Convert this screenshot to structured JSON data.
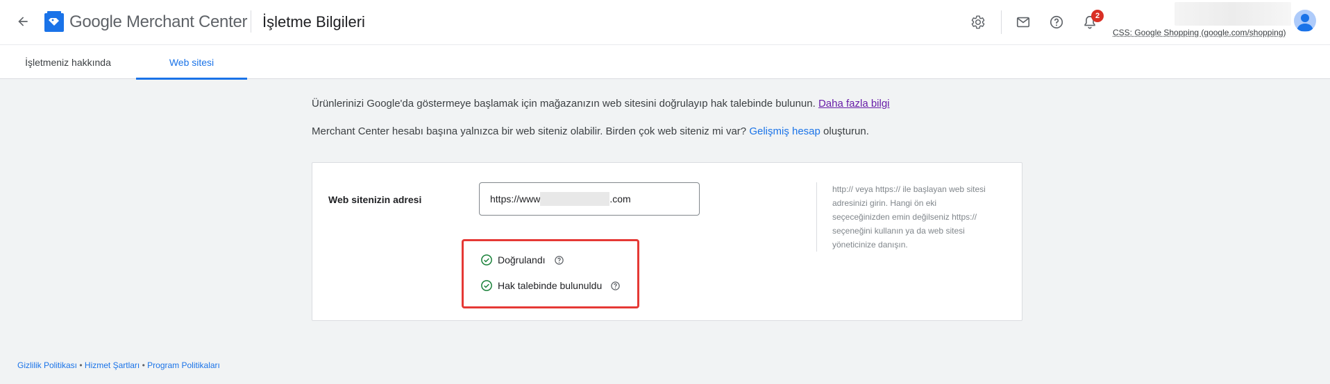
{
  "header": {
    "back_icon": "arrow-back-icon",
    "brand_google": "Google",
    "brand_product": "Merchant Center",
    "page_title": "İşletme Bilgileri",
    "icons": [
      "settings-icon",
      "mail-icon",
      "help-icon",
      "notifications-icon"
    ],
    "notification_count": "2",
    "account_label": "CSS: Google Shopping (google.com/shopping)"
  },
  "tabs": [
    {
      "label": "İşletmeniz hakkında",
      "active": false
    },
    {
      "label": "Web sitesi",
      "active": true
    }
  ],
  "intro": {
    "line1_text": "Ürünlerinizi Google'da göstermeye başlamak için mağazanızın web sitesini doğrulayıp hak talebinde bulunun.",
    "line1_link": "Daha fazla bilgi",
    "line2_text": "Merchant Center hesabı başına yalnızca bir web siteniz olabilir. Birden çok web siteniz mi var?",
    "line2_link": "Gelişmiş hesap",
    "line2_after": "oluşturun."
  },
  "website_card": {
    "field_label": "Web sitenizin adresi",
    "url_prefix": "https://www",
    "url_suffix": ".com",
    "helper_text": "http:// veya https:// ile başlayan web sitesi adresinizi girin. Hangi ön eki seçeceğinizden emin değilseniz https:// seçeneğini kullanın ya da web sitesi yöneticinize danışın.",
    "statuses": [
      {
        "label": "Doğrulandı",
        "icon": "check-circle-icon"
      },
      {
        "label": "Hak talebinde bulunuldu",
        "icon": "check-circle-icon"
      }
    ]
  },
  "footer": {
    "links": [
      "Gizlilik Politikası",
      "Hizmet Şartları",
      "Program Politikaları"
    ],
    "separator": "•"
  },
  "colors": {
    "accent": "#1a73e8",
    "success": "#188038",
    "highlight": "#e53935",
    "badge": "#d93025"
  }
}
